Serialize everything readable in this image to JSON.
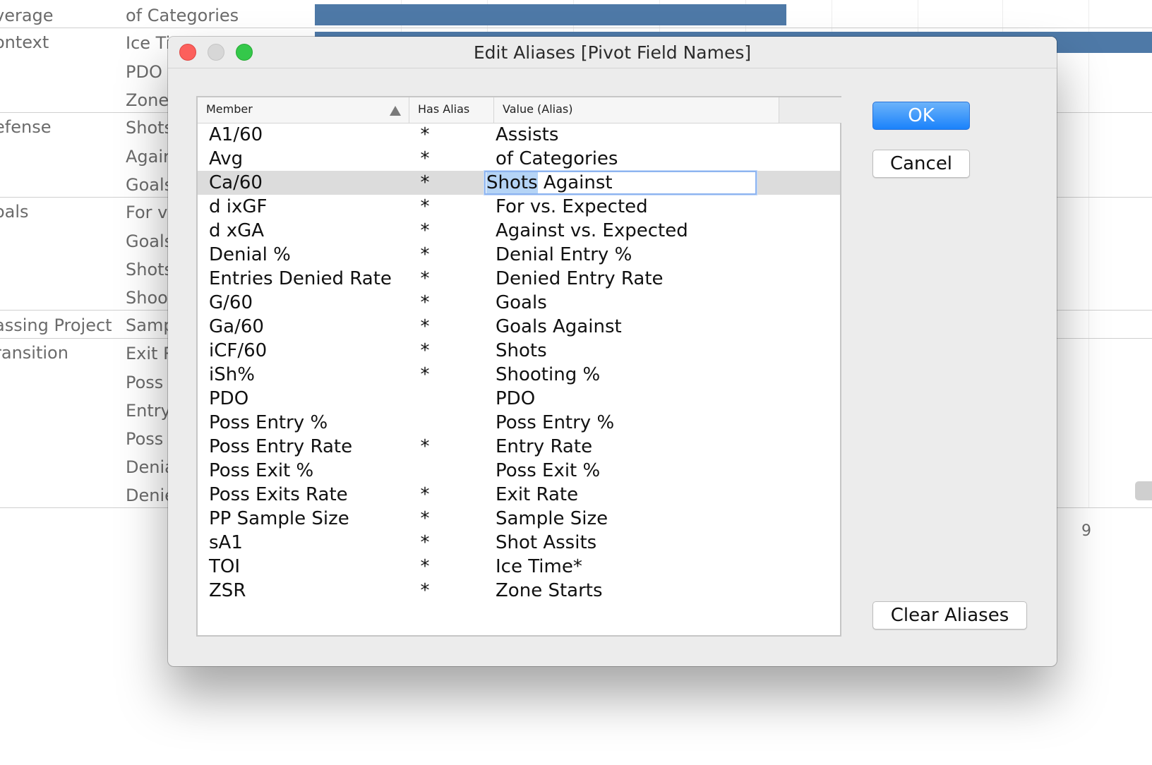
{
  "background": {
    "rows": [
      {
        "category": "verage",
        "subcategory": "of Categories"
      },
      {
        "category": "ontext",
        "subcategory": "Ice Ti"
      },
      {
        "category": "",
        "subcategory": "PDO"
      },
      {
        "category": "",
        "subcategory": "Zone"
      },
      {
        "category": "efense",
        "subcategory": "Shots"
      },
      {
        "category": "",
        "subcategory": "Agair"
      },
      {
        "category": "",
        "subcategory": "Goals"
      },
      {
        "category": "oals",
        "subcategory": "For vs"
      },
      {
        "category": "",
        "subcategory": "Goals"
      },
      {
        "category": "",
        "subcategory": "Shots"
      },
      {
        "category": "",
        "subcategory": "Shoot"
      },
      {
        "category": "assing Project",
        "subcategory": "Samp"
      },
      {
        "category": "ransition",
        "subcategory": "Exit R"
      },
      {
        "category": "",
        "subcategory": "Poss"
      },
      {
        "category": "",
        "subcategory": "Entry"
      },
      {
        "category": "",
        "subcategory": "Poss"
      },
      {
        "category": "",
        "subcategory": "Denia"
      },
      {
        "category": "",
        "subcategory": "Denie"
      }
    ],
    "axis_tick": "9",
    "bar_color": "#4e79a7"
  },
  "dialog": {
    "title": "Edit Aliases [Pivot Field Names]",
    "columns": {
      "member": "Member",
      "has_alias": "Has Alias",
      "value": "Value (Alias)"
    },
    "sort_indicator": "sort-ascending-icon",
    "rows": [
      {
        "member": "A1/60",
        "has_alias": "*",
        "value": "Assists"
      },
      {
        "member": "Avg",
        "has_alias": "*",
        "value": "of Categories"
      },
      {
        "member": "Ca/60",
        "has_alias": "*",
        "value": "Shots Against"
      },
      {
        "member": "d ixGF",
        "has_alias": "*",
        "value": "For vs. Expected"
      },
      {
        "member": "d xGA",
        "has_alias": "*",
        "value": "Against vs. Expected"
      },
      {
        "member": "Denial %",
        "has_alias": "*",
        "value": "Denial Entry %"
      },
      {
        "member": "Entries Denied Rate",
        "has_alias": "*",
        "value": "Denied Entry Rate"
      },
      {
        "member": "G/60",
        "has_alias": "*",
        "value": "Goals"
      },
      {
        "member": "Ga/60",
        "has_alias": "*",
        "value": "Goals Against"
      },
      {
        "member": "iCF/60",
        "has_alias": "*",
        "value": "Shots"
      },
      {
        "member": "iSh%",
        "has_alias": "*",
        "value": "Shooting %"
      },
      {
        "member": "PDO",
        "has_alias": "",
        "value": "PDO"
      },
      {
        "member": "Poss Entry %",
        "has_alias": "",
        "value": "Poss Entry %"
      },
      {
        "member": "Poss Entry Rate",
        "has_alias": "*",
        "value": "Entry Rate"
      },
      {
        "member": "Poss Exit %",
        "has_alias": "",
        "value": "Poss Exit %"
      },
      {
        "member": "Poss Exits Rate",
        "has_alias": "*",
        "value": "Exit Rate"
      },
      {
        "member": "PP Sample Size",
        "has_alias": "*",
        "value": "Sample Size"
      },
      {
        "member": "sA1",
        "has_alias": "*",
        "value": "Shot Assits"
      },
      {
        "member": "TOI",
        "has_alias": "*",
        "value": "Ice Time*"
      },
      {
        "member": "ZSR",
        "has_alias": "*",
        "value": "Zone Starts"
      }
    ],
    "selected_row_index": 2,
    "editing": {
      "selected_text": "Shots",
      "rest_text": " Against"
    },
    "buttons": {
      "ok": "OK",
      "cancel": "Cancel",
      "clear": "Clear Aliases"
    },
    "colors": {
      "accent": "#1a82fb",
      "selection": "#b5d4f6",
      "close": "#fc605c",
      "maximize": "#34c84a"
    }
  }
}
